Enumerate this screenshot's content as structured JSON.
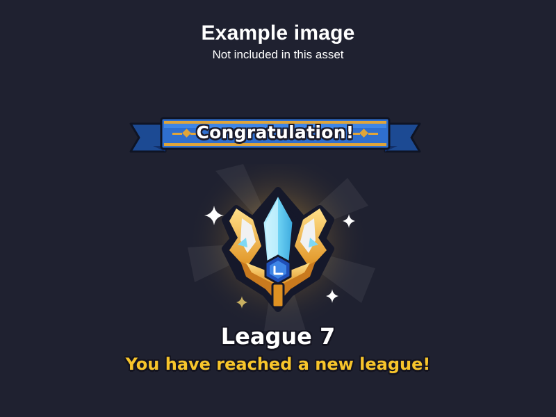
{
  "watermark": {
    "title": "Example image",
    "subtitle": "Not included in this asset"
  },
  "banner": {
    "label": "Congratulation!"
  },
  "league": {
    "title": "League 7",
    "message": "You have reached a new league!"
  },
  "icons": {
    "badge": "league-crest-icon",
    "sparkles": "sparkle-icon"
  },
  "colors": {
    "background": "#1f2130",
    "banner_blue": "#2f6fcf",
    "banner_gold": "#e0a53a",
    "message_yellow": "#f7c52b",
    "crystal_blue": "#7fd8f5"
  }
}
